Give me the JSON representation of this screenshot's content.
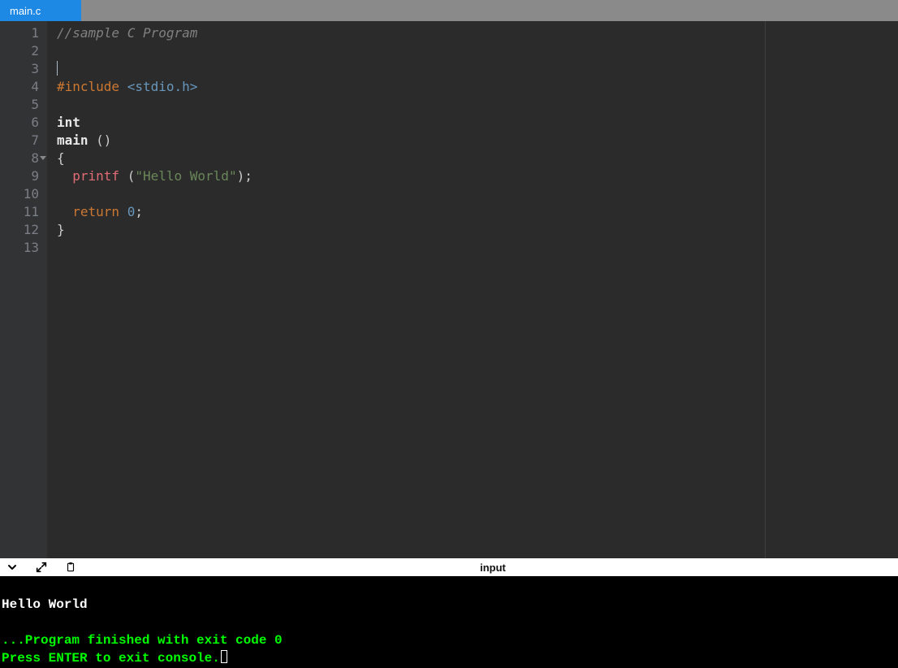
{
  "tabs": {
    "active": {
      "label": "main.c"
    }
  },
  "editor": {
    "lines": [
      {
        "n": "1",
        "tokens": [
          {
            "cls": "tok-comment",
            "t": "//sample C Program"
          }
        ]
      },
      {
        "n": "2",
        "tokens": []
      },
      {
        "n": "3",
        "current": true,
        "cursor": true,
        "tokens": []
      },
      {
        "n": "4",
        "tokens": [
          {
            "cls": "tok-preproc",
            "t": "#include"
          },
          {
            "cls": "tok-plain",
            "t": " "
          },
          {
            "cls": "tok-angle",
            "t": "<stdio.h>"
          }
        ]
      },
      {
        "n": "5",
        "tokens": []
      },
      {
        "n": "6",
        "tokens": [
          {
            "cls": "tok-plain",
            "t": "int"
          }
        ]
      },
      {
        "n": "7",
        "tokens": [
          {
            "cls": "tok-plain",
            "t": "main "
          },
          {
            "cls": "tok-punct",
            "t": "()"
          }
        ]
      },
      {
        "n": "8",
        "fold": true,
        "tokens": [
          {
            "cls": "tok-punct",
            "t": "{"
          }
        ]
      },
      {
        "n": "9",
        "tokens": [
          {
            "cls": "tok-plain",
            "t": "  "
          },
          {
            "cls": "tok-func",
            "t": "printf"
          },
          {
            "cls": "tok-plain",
            "t": " "
          },
          {
            "cls": "tok-punct",
            "t": "("
          },
          {
            "cls": "tok-string",
            "t": "\"Hello World\""
          },
          {
            "cls": "tok-punct",
            "t": ");"
          }
        ]
      },
      {
        "n": "10",
        "tokens": []
      },
      {
        "n": "11",
        "tokens": [
          {
            "cls": "tok-plain",
            "t": "  "
          },
          {
            "cls": "tok-keyword",
            "t": "return"
          },
          {
            "cls": "tok-plain",
            "t": " "
          },
          {
            "cls": "tok-number",
            "t": "0"
          },
          {
            "cls": "tok-punct",
            "t": ";"
          }
        ]
      },
      {
        "n": "12",
        "tokens": [
          {
            "cls": "tok-punct",
            "t": "}"
          }
        ]
      },
      {
        "n": "13",
        "tokens": []
      }
    ]
  },
  "panelbar": {
    "input_label": "input"
  },
  "console": {
    "output": "Hello World",
    "finished": "...Program finished with exit code 0",
    "prompt": "Press ENTER to exit console."
  }
}
